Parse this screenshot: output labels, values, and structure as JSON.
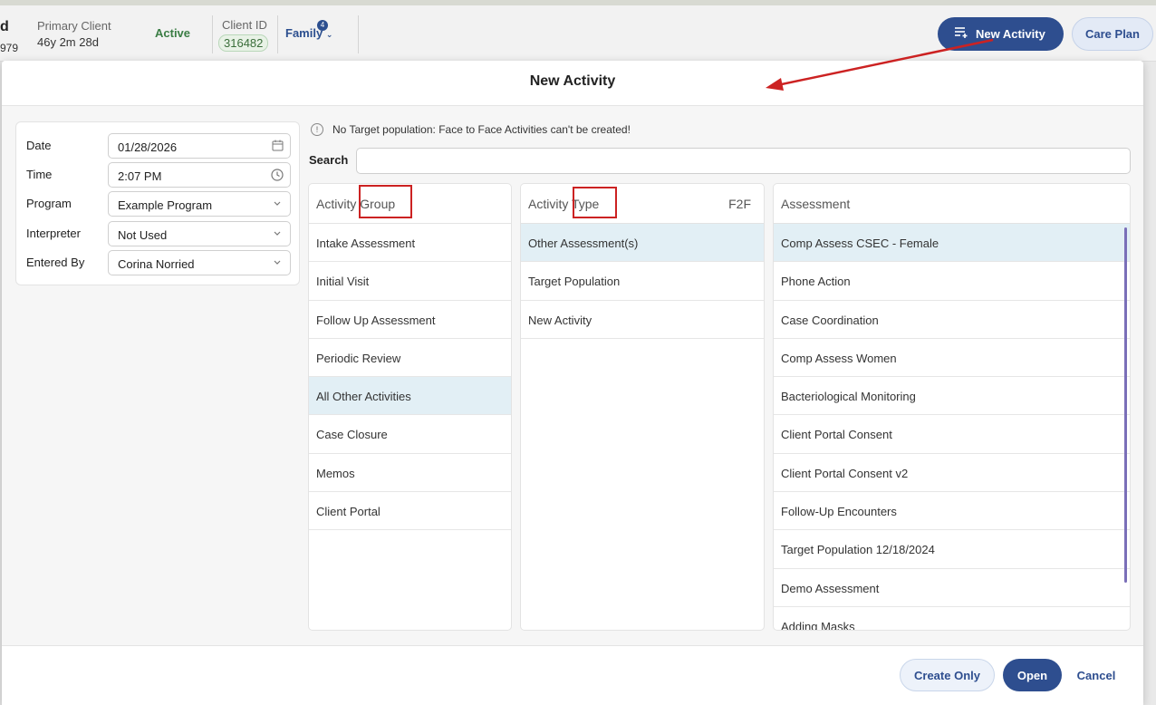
{
  "background": {
    "client_name_fragment": "d",
    "client_dob_fragment": "979",
    "primary_client_label": "Primary Client",
    "age": "46y 2m 28d",
    "status": "Active",
    "client_id_label": "Client ID",
    "client_id": "316482",
    "family_label": "Family",
    "family_count": "4",
    "new_activity_button": "New Activity",
    "care_plan_button": "Care Plan"
  },
  "modal": {
    "title": "New Activity",
    "form": {
      "date_label": "Date",
      "date_value": "01/28/2026",
      "time_label": "Time",
      "time_value": "2:07 PM",
      "program_label": "Program",
      "program_value": "Example Program",
      "interpreter_label": "Interpreter",
      "interpreter_value": "Not Used",
      "entered_by_label": "Entered By",
      "entered_by_value": "Corina Norried"
    },
    "warning": "No Target population: Face to Face Activities can't be created!",
    "search_label": "Search",
    "search_value": "",
    "activity_group": {
      "header": "Activity Group",
      "items": [
        "Intake Assessment",
        "Initial Visit",
        "Follow Up Assessment",
        "Periodic Review",
        "All Other Activities",
        "Case Closure",
        "Memos",
        "Client Portal"
      ],
      "selected": "All Other Activities"
    },
    "activity_type": {
      "header": "Activity Type",
      "header_right": "F2F",
      "items": [
        "Other Assessment(s)",
        "Target Population",
        "New Activity"
      ],
      "selected": "Other Assessment(s)"
    },
    "assessment": {
      "header": "Assessment",
      "items": [
        "Comp Assess CSEC - Female",
        "Phone Action",
        "Case Coordination",
        "Comp Assess Women",
        "Bacteriological Monitoring",
        "Client Portal Consent",
        "Client Portal Consent v2",
        "Follow-Up Encounters",
        "Target Population 12/18/2024",
        "Demo Assessment",
        "Adding Masks"
      ],
      "selected": "Comp Assess CSEC - Female"
    },
    "footer": {
      "create_only": "Create Only",
      "open": "Open",
      "cancel": "Cancel"
    }
  },
  "colors": {
    "primary": "#2e4e8f",
    "selected_row": "#e2eff5",
    "annotation_red": "#cc2222",
    "active_green": "#3a7d44"
  }
}
